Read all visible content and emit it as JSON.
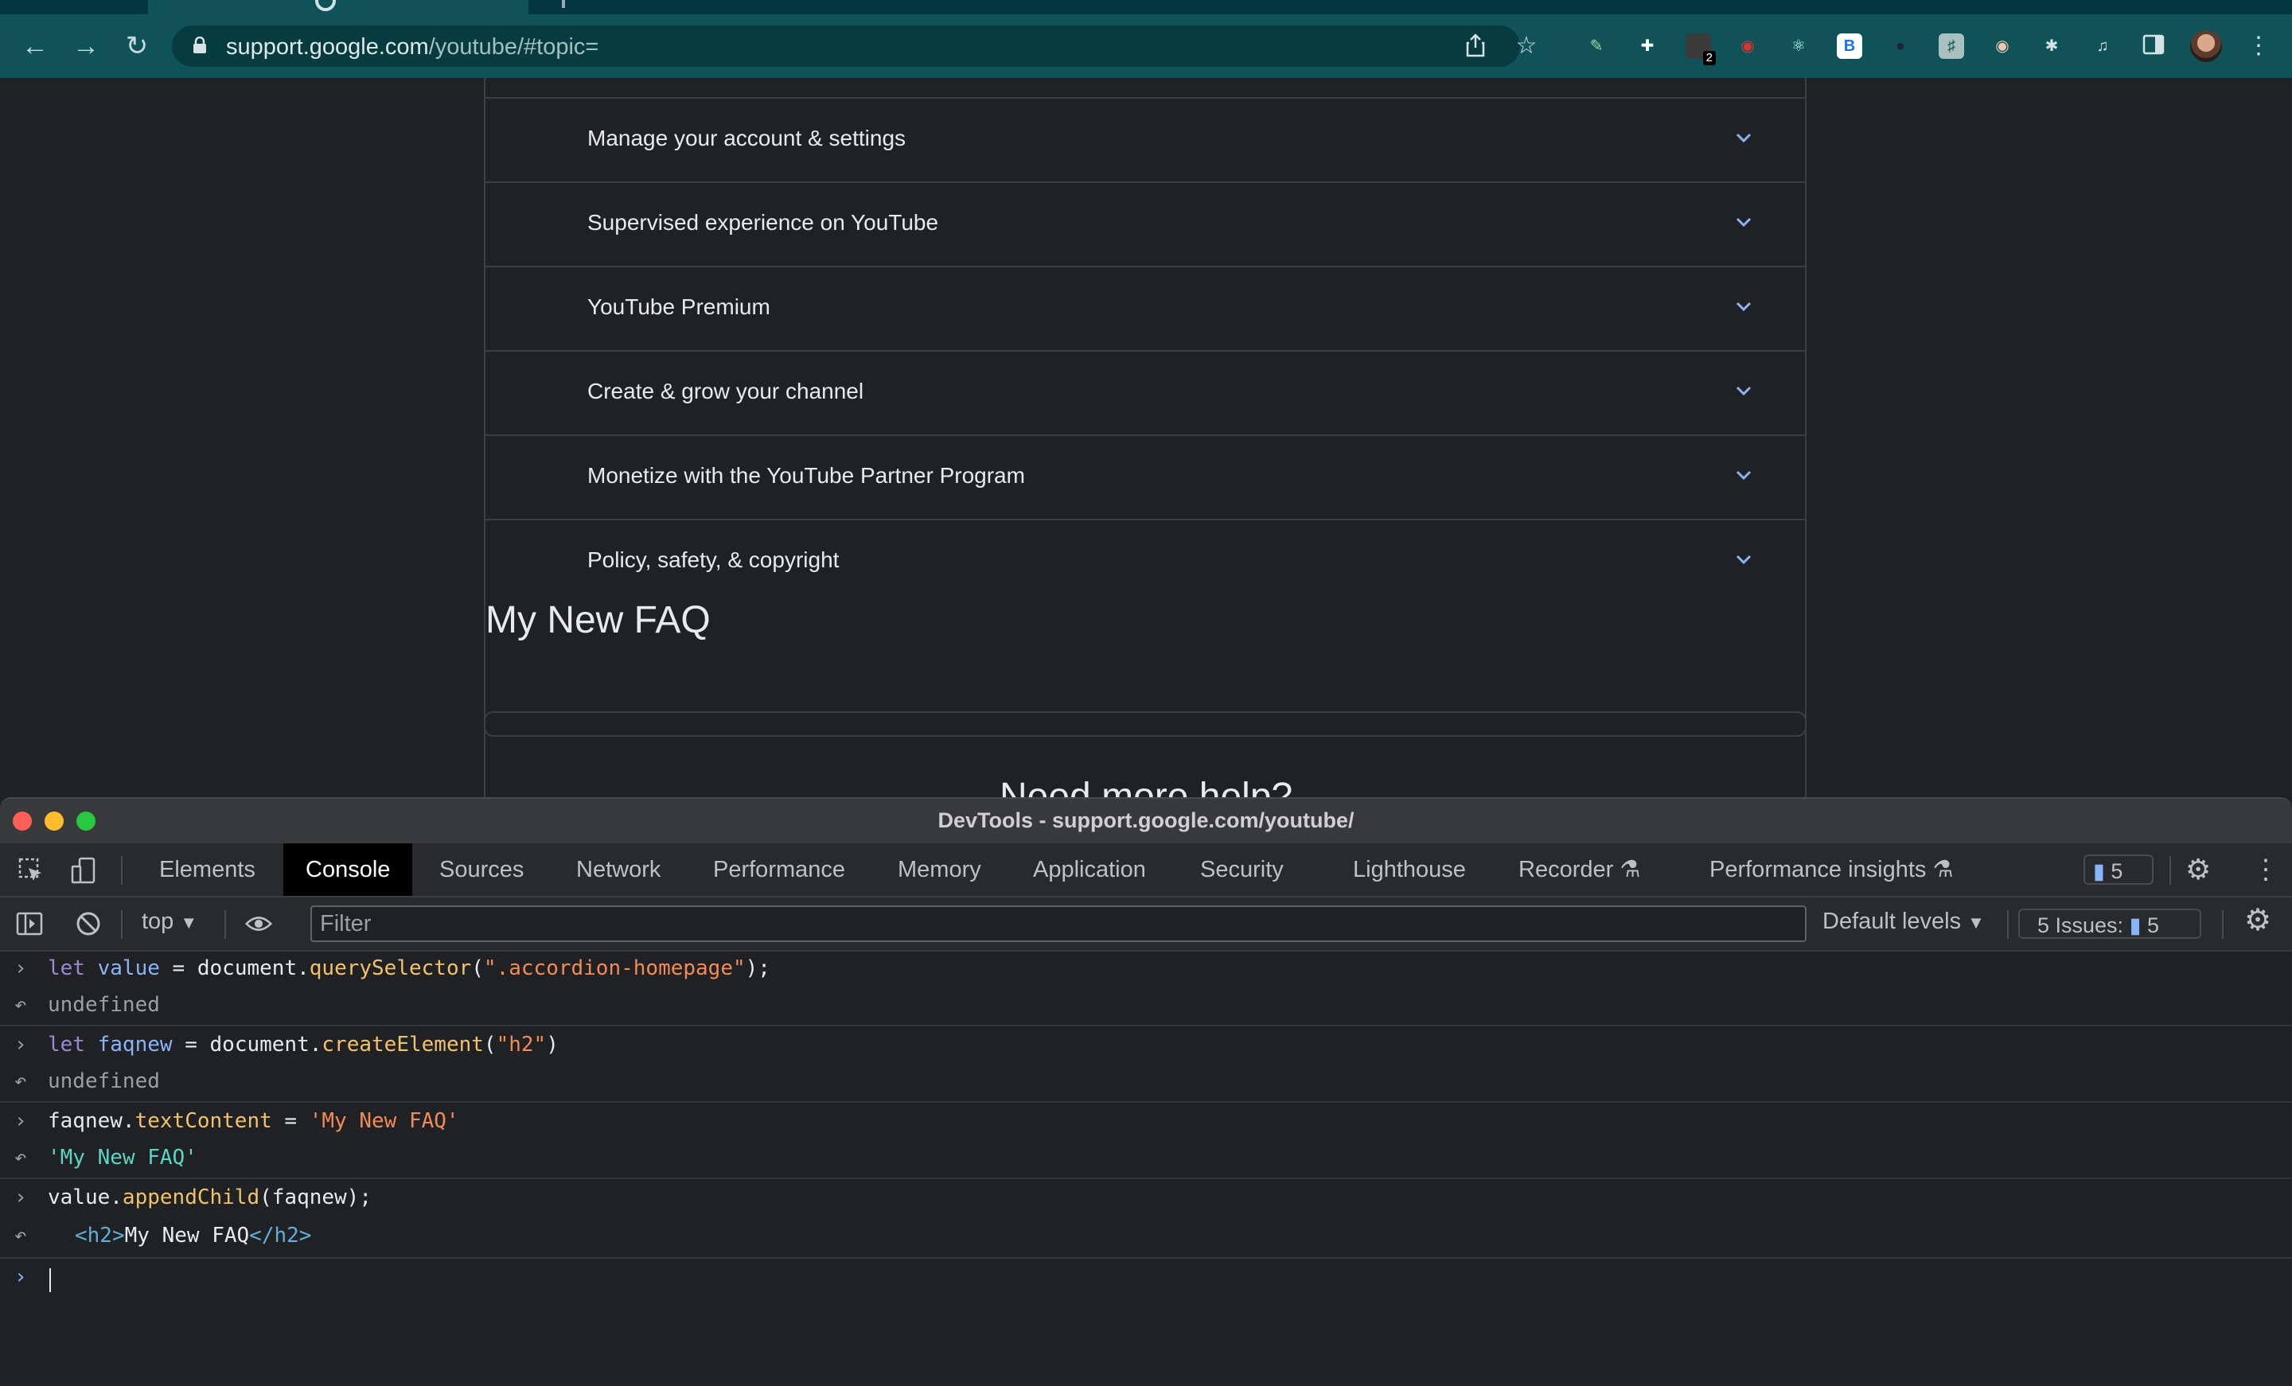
{
  "browser": {
    "url_host": "support.google.com",
    "url_path": "/youtube/#topic="
  },
  "page": {
    "accordion_items": [
      {
        "label": "Manage your account & settings"
      },
      {
        "label": "Supervised experience on YouTube"
      },
      {
        "label": "YouTube Premium"
      },
      {
        "label": "Create & grow your channel"
      },
      {
        "label": "Monetize with the YouTube Partner Program"
      },
      {
        "label": "Policy, safety, & copyright"
      }
    ],
    "faq_title": "My New FAQ",
    "help_title": "Need more help?"
  },
  "extensions": {
    "badge_count": "2",
    "b_label": "B"
  },
  "devtools": {
    "window_title": "DevTools - support.google.com/youtube/",
    "tabs": [
      "Elements",
      "Console",
      "Sources",
      "Network",
      "Performance",
      "Memory",
      "Application",
      "Security",
      "Lighthouse",
      "Recorder",
      "Performance insights"
    ],
    "active_tab": "Console",
    "issues_count": "5",
    "context": "top",
    "filter_placeholder": "Filter",
    "levels": "Default levels",
    "issues_label": "5 Issues:",
    "issues_badge_count": "5"
  },
  "console": {
    "l1": {
      "kw": "let",
      "var": "value",
      "eq": " = ",
      "obj": "document.",
      "fn": "querySelector",
      "open": "(",
      "str": "\".accordion-homepage\"",
      "close": ");"
    },
    "r1": "undefined",
    "l2": {
      "kw": "let",
      "var": "faqnew",
      "eq": " = ",
      "obj": "document.",
      "fn": "createElement",
      "open": "(",
      "str": "\"h2\"",
      "close": ")"
    },
    "r2": "undefined",
    "l3": {
      "obj": "faqnew.",
      "prop": "textContent",
      "eq": " = ",
      "str": "'My New FAQ'"
    },
    "r3": "'My New FAQ'",
    "l4": {
      "obj": "value.",
      "fn": "appendChild",
      "args": "(faqnew);"
    },
    "r4": {
      "open_tag": "<h2>",
      "text": "My New FAQ",
      "close_tag": "</h2>"
    }
  },
  "grammarly": {
    "letter": "G"
  }
}
